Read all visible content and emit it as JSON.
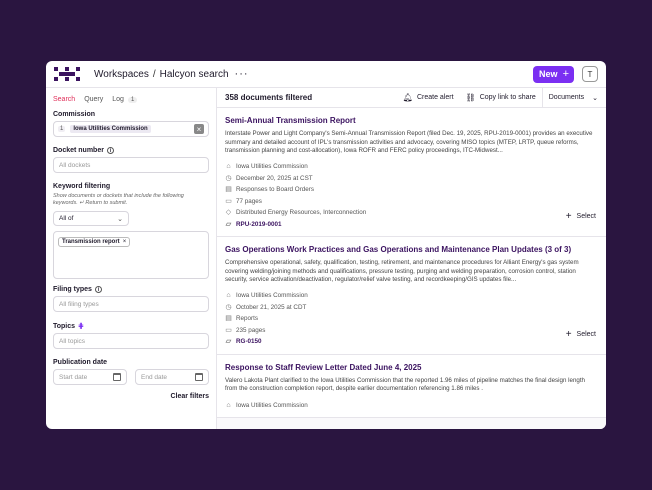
{
  "header": {
    "workspace": "Workspaces",
    "separator": "/",
    "project": "Halcyon search",
    "more": "···",
    "new_label": "New",
    "new_plus": "+",
    "avatar": "T"
  },
  "sidebar": {
    "tabs": [
      {
        "label": "Search"
      },
      {
        "label": "Query"
      },
      {
        "label": "Log"
      }
    ],
    "log_count": "1",
    "commission": {
      "label": "Commission",
      "chip_count": "1",
      "chip_value": "Iowa Utilities Commission",
      "clear": "×"
    },
    "docket": {
      "label": "Docket number",
      "placeholder": "All dockets"
    },
    "keyword": {
      "label": "Keyword filtering",
      "help": "Show documents or dockets that include the following keywords. ↵ Return to submit.",
      "mode": "All of",
      "chip": "Transmission report",
      "chip_x": "×"
    },
    "filing_types": {
      "label": "Filing types",
      "placeholder": "All filing types"
    },
    "topics": {
      "label": "Topics",
      "placeholder": "All topics"
    },
    "publication": {
      "label": "Publication date",
      "start": "Start date",
      "end": "End date"
    },
    "clear_filters": "Clear filters"
  },
  "main": {
    "count": "358 documents filtered",
    "create_alert": "Create alert",
    "copy_link": "Copy link to share",
    "documents": "Documents",
    "select_label": "Select",
    "results": [
      {
        "title": "Semi-Annual Transmission Report",
        "summary": "Interstate Power and Light Company's Semi-Annual Transmission Report (filed Dec. 19, 2025, RPU-2019-0001) provides an executive summary and detailed account of IPL's transmission activities and advocacy, covering MISO topics (MTEP, LRTP, queue reforms, transmission planning and cost-allocation), Iowa ROFR and FERC policy proceedings, ITC-Midwest...",
        "commission": "Iowa Utilities Commission",
        "date": "December 20, 2025 at CST",
        "type": "Responses to Board Orders",
        "pages": "77 pages",
        "topics": "Distributed Energy Resources, Interconnection",
        "docket": "RPU-2019-0001"
      },
      {
        "title": "Gas Operations Work Practices and Gas Operations and Maintenance Plan Updates (3 of 3)",
        "summary": "Comprehensive operational, safety, qualification, testing, retirement, and maintenance procedures for Alliant Energy's gas system covering welding/joining methods and qualifications, pressure testing, purging and welding preparation, corrosion control, station security, service activation/deactivation, regulator/relief valve testing, and recordkeeping/GIS updates file...",
        "commission": "Iowa Utilities Commission",
        "date": "October 21, 2025 at CDT",
        "type": "Reports",
        "pages": "235 pages",
        "docket": "RG-0150"
      },
      {
        "title": "Response to Staff Review Letter Dated June 4, 2025",
        "summary": "Valero Lakota Plant clarified to the Iowa Utilities Commission that the reported 1.96 miles of pipeline matches the final design length from the construction completion report, despite earlier documentation referencing 1.86 miles .",
        "commission": "Iowa Utilities Commission"
      }
    ]
  }
}
